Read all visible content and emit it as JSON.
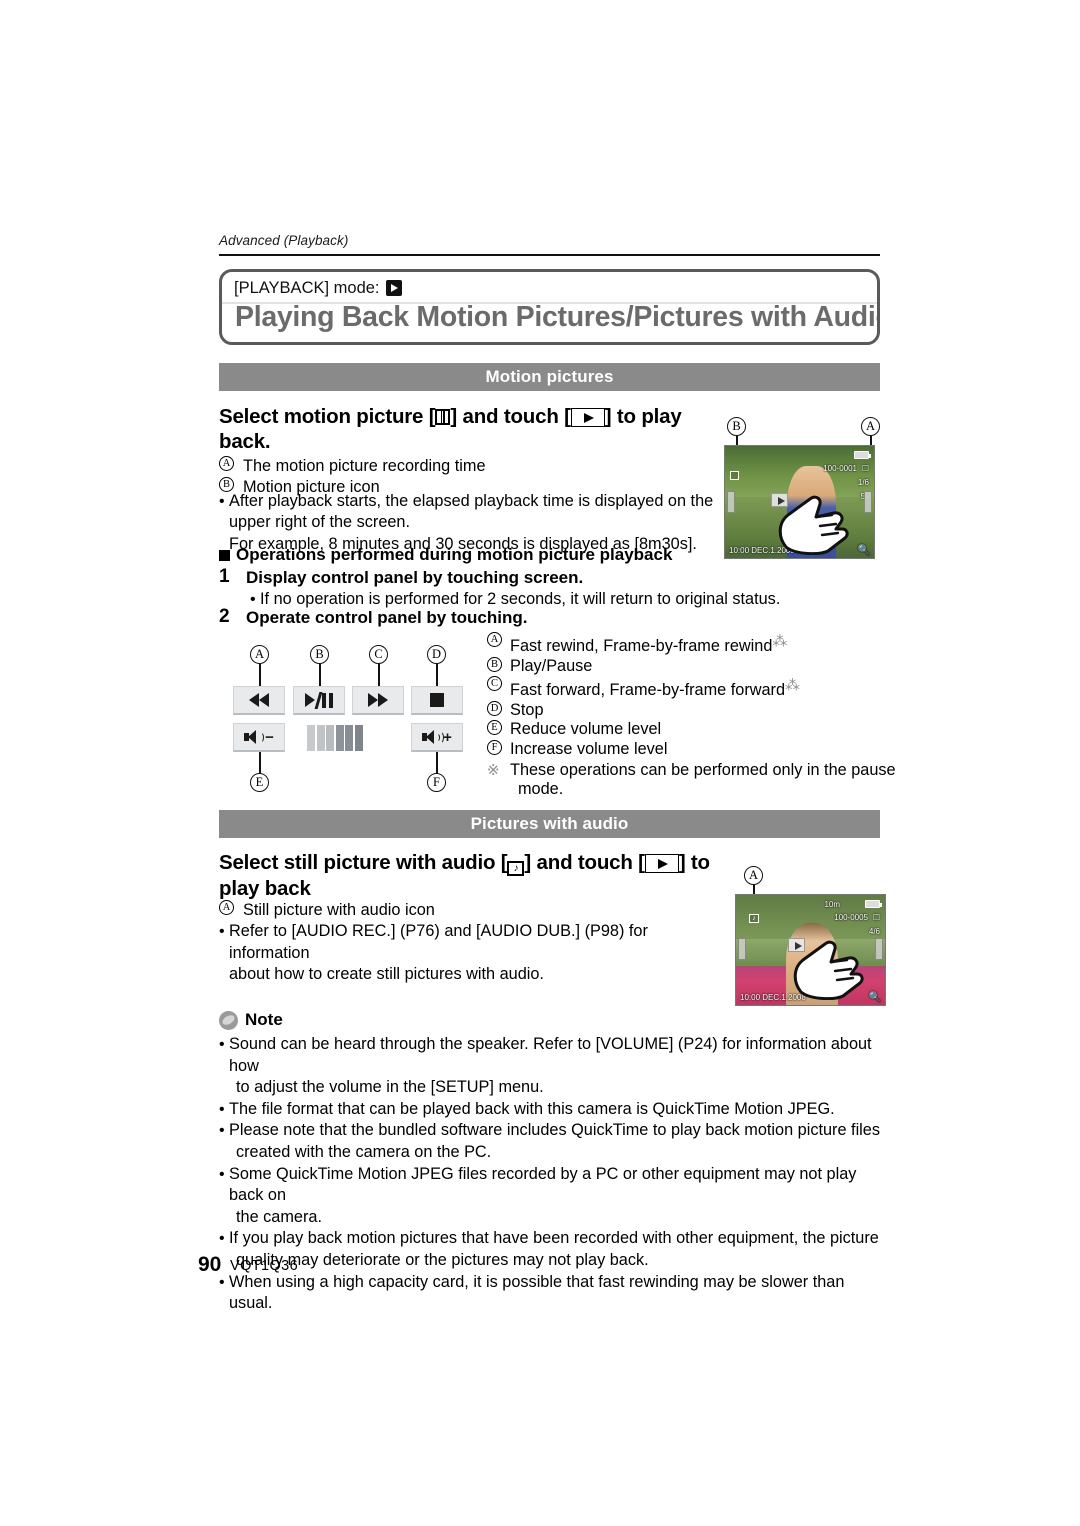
{
  "running_head": "Advanced (Playback)",
  "title_box": {
    "mode_label": "[PLAYBACK] mode:",
    "mode_icon": "playback-mode-icon",
    "title": "Playing Back Motion Pictures/Pictures with Audio"
  },
  "sections": {
    "motion": {
      "band_label": "Motion pictures",
      "heading_part1": "Select motion picture [",
      "heading_icon1": "film-strip-icon",
      "heading_part2": "] and touch [",
      "heading_icon2": "play-button-icon",
      "heading_part3": "] to play back.",
      "legend_a_key": "A",
      "legend_a": "The motion picture recording time",
      "legend_b_key": "B",
      "legend_b": "Motion picture icon",
      "bullet1_line1": "After playback starts, the elapsed playback time is displayed on the",
      "bullet1_line2": "upper right of the screen.",
      "bullet1_line3": "For example, 8 minutes and 30 seconds is displayed as [8m30s].",
      "square_heading": "Operations performed during motion picture playback",
      "step1_num": "1",
      "step1_text": "Display control panel by touching screen.",
      "step1_bullet": "If no operation is performed for 2 seconds, it will return to original status.",
      "step2_num": "2",
      "step2_text": "Operate control panel by touching."
    },
    "audio": {
      "band_label": "Pictures with audio",
      "heading_part1": "Select still picture with audio [",
      "heading_icon1": "audio-picture-icon",
      "heading_part2": "] and touch [",
      "heading_icon2": "play-button-icon",
      "heading_part3": "] to play back",
      "legend_a_key": "A",
      "legend_a": "Still picture with audio icon",
      "bullet1_line1": "Refer to [AUDIO REC.] (P76) and [AUDIO DUB.] (P98) for information",
      "bullet1_line2": "about how to create still pictures with audio."
    }
  },
  "control_panel": {
    "callouts": [
      "A",
      "B",
      "C",
      "D",
      "E",
      "F"
    ],
    "buttons": [
      {
        "key": "A",
        "name": "fast-rewind-button"
      },
      {
        "key": "B",
        "name": "play-pause-button"
      },
      {
        "key": "C",
        "name": "fast-forward-button"
      },
      {
        "key": "D",
        "name": "stop-button"
      },
      {
        "key": "E",
        "name": "volume-down-button",
        "sign": "−"
      },
      {
        "key": "F",
        "name": "volume-up-button",
        "sign": "+"
      }
    ],
    "legend": [
      {
        "key": "A",
        "text": "Fast rewind, Frame-by-frame rewind",
        "asterisk": true
      },
      {
        "key": "B",
        "text": "Play/Pause",
        "asterisk": false
      },
      {
        "key": "C",
        "text": "Fast forward, Frame-by-frame forward",
        "asterisk": true
      },
      {
        "key": "D",
        "text": "Stop",
        "asterisk": false
      },
      {
        "key": "E",
        "text": "Reduce volume level",
        "asterisk": false
      },
      {
        "key": "F",
        "text": "Increase volume level",
        "asterisk": false
      }
    ],
    "footnote_line1": "These operations can be performed only in the pause",
    "footnote_line2": "mode.",
    "footnote_mark": "※"
  },
  "camera_screens": {
    "motion": {
      "callout_a": "A",
      "callout_b": "B",
      "osd_file": "100-0001",
      "osd_count": "1/6",
      "osd_time": "5s",
      "osd_datetime": "10:00  DEC.1.2008"
    },
    "audio": {
      "callout_a": "A",
      "osd_res": "10m",
      "osd_file": "100-0005",
      "osd_count": "4/6",
      "osd_datetime": "10:00  DEC.1.2008"
    }
  },
  "note": {
    "heading": "Note",
    "items": [
      [
        "Sound can be heard through the speaker. Refer to [VOLUME] (P24) for information about how",
        "to adjust the volume in the [SETUP] menu."
      ],
      [
        "The file format that can be played back with this camera is QuickTime Motion JPEG."
      ],
      [
        "Please note that the bundled software includes QuickTime to play back motion picture files",
        "created with the camera on the PC."
      ],
      [
        "Some QuickTime Motion JPEG files recorded by a PC or other equipment may not play back on",
        "the camera."
      ],
      [
        "If you play back motion pictures that have been recorded with other equipment, the picture",
        "quality may deteriorate or the pictures may not play back."
      ],
      [
        "When using a high capacity card, it is possible that fast rewinding may be slower than usual."
      ]
    ]
  },
  "footer": {
    "page_number": "90",
    "doc_code": "VQT1Q36"
  },
  "colors": {
    "band": "#8a8a8a",
    "title_text": "#6b6b6b",
    "title_border": "#5a5a5a"
  }
}
